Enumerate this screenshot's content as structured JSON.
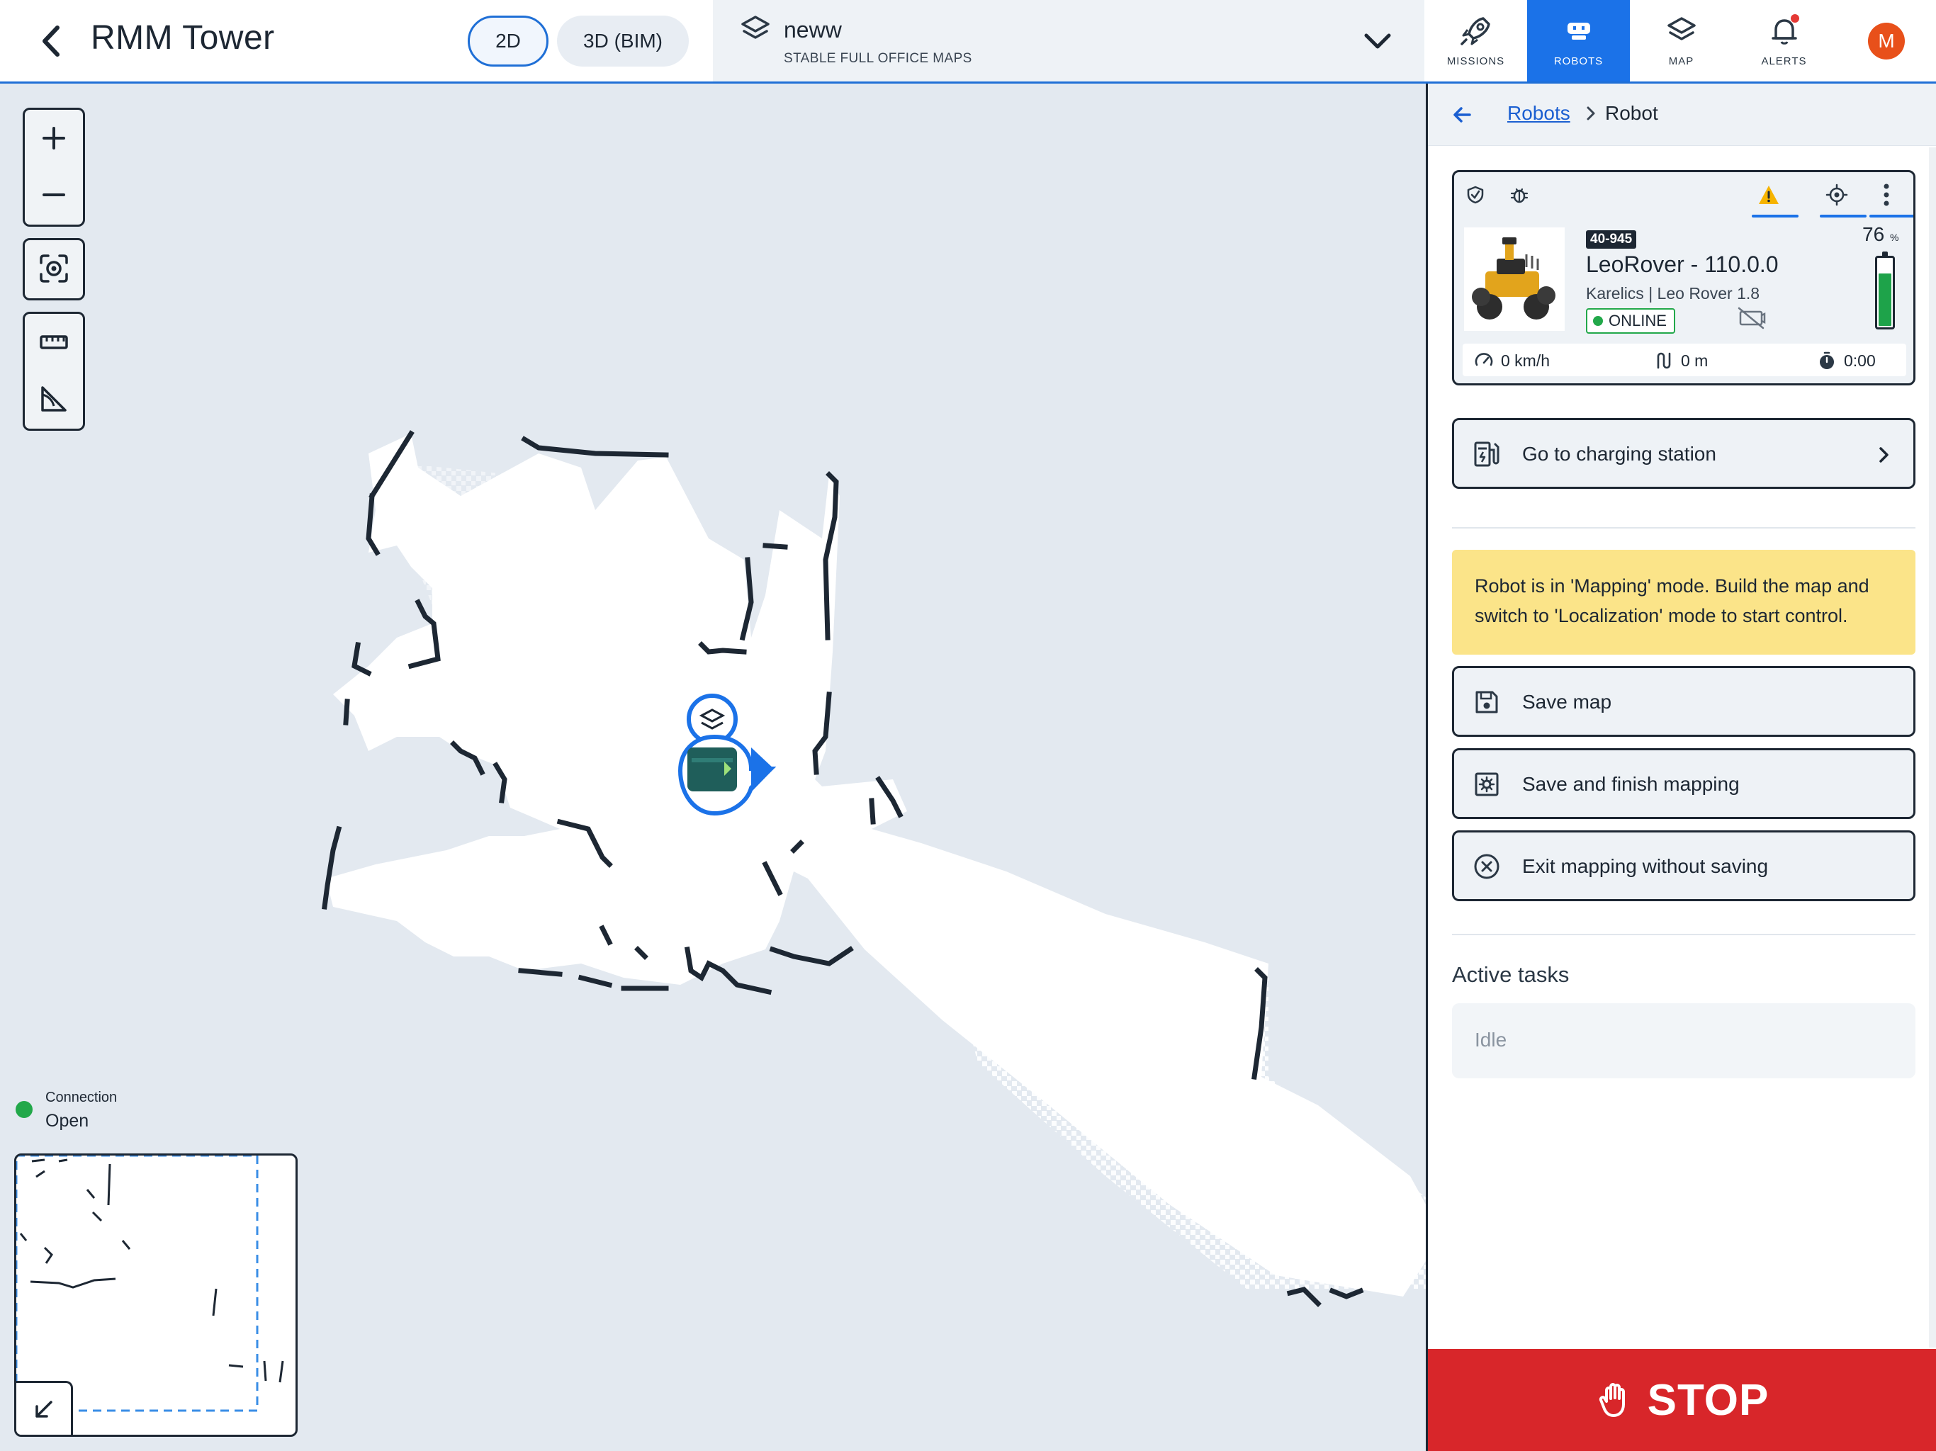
{
  "header": {
    "title": "RMM Tower",
    "view_modes": [
      "2D",
      "3D (BIM)"
    ],
    "active_view": "2D",
    "map_selector": {
      "name": "neww",
      "subtitle": "STABLE FULL OFFICE MAPS"
    },
    "nav": [
      {
        "label": "MISSIONS",
        "icon": "rocket-icon",
        "active": false
      },
      {
        "label": "ROBOTS",
        "icon": "robot-icon",
        "active": true
      },
      {
        "label": "MAP",
        "icon": "layers-icon",
        "active": false
      },
      {
        "label": "ALERTS",
        "icon": "bell-icon",
        "active": false
      }
    ],
    "avatar_initial": "M"
  },
  "map": {
    "connection_label": "Connection",
    "connection_value": "Open",
    "tools": [
      "zoom-in-icon",
      "zoom-out-icon",
      "focus-robot-icon",
      "ruler-icon",
      "angle-measure-icon"
    ]
  },
  "panel": {
    "breadcrumb": {
      "parent": "Robots",
      "current": "Robot"
    },
    "robot": {
      "id_badge": "40-945",
      "name": "LeoRover - 110.0.0",
      "model": "Karelics | Leo Rover 1.8",
      "status": "ONLINE",
      "battery_percent": "76",
      "battery_unit": "%",
      "battery_level": 0.76,
      "speed": "0 km/h",
      "distance": "0 m",
      "duration": "0:00"
    },
    "charging_label": "Go to charging station",
    "mapping_warning": "Robot is in 'Mapping' mode. Build the map and switch to 'Localization' mode to start control.",
    "actions": {
      "save_map": "Save map",
      "save_finish": "Save and finish mapping",
      "exit_mapping": "Exit mapping without saving"
    },
    "active_tasks_title": "Active tasks",
    "active_tasks_value": "Idle",
    "stop_label": "STOP"
  },
  "colors": {
    "accent": "#1b72e8",
    "online": "#22a84a",
    "warning_bg": "#fbe489",
    "stop": "#d8262a",
    "map_wall": "#1d2733"
  }
}
